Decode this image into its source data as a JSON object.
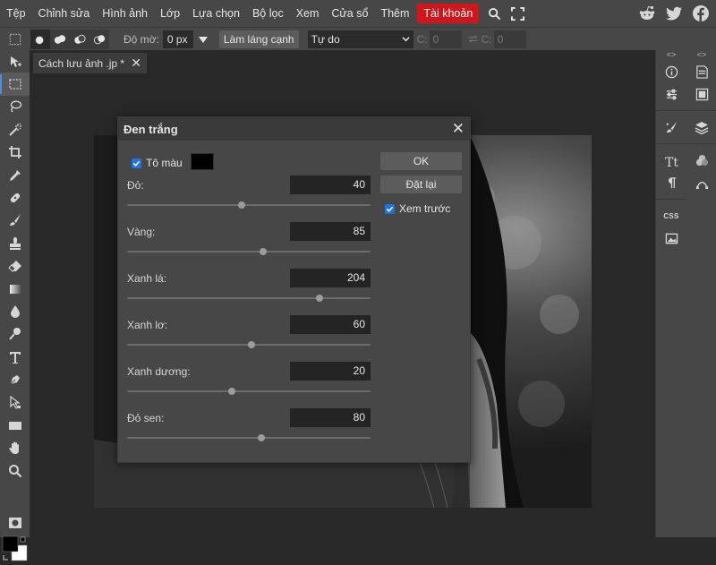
{
  "menu": {
    "items": [
      "Tệp",
      "Chỉnh sửa",
      "Hình ảnh",
      "Lớp",
      "Lựa chọn",
      "Bộ lọc",
      "Xem",
      "Cửa sổ",
      "Thêm"
    ],
    "account": "Tài khoản",
    "icons": [
      "search-icon",
      "fullscreen-icon"
    ],
    "social": [
      "reddit-icon",
      "twitter-icon",
      "facebook-icon"
    ]
  },
  "options": {
    "feather_label": "Độ mờ:",
    "feather_value": "0 px",
    "antialias_button": "Làm láng cạnh",
    "mode_value": "Tự do",
    "width_label": "C:",
    "width_value": "0",
    "height_label": "C:",
    "height_value": "0"
  },
  "tab": {
    "title": "Cách lưu ảnh .jp *",
    "close": "✕"
  },
  "dialog": {
    "title": "Đen trắng",
    "close": "✕",
    "tint_label": "Tô màu",
    "tint_checked": true,
    "tint_color": "#000000",
    "ok_label": "OK",
    "reset_label": "Đặt lại",
    "preview_label": "Xem trước",
    "preview_checked": true,
    "sliders": [
      {
        "label": "Đỏ:",
        "value": "40",
        "fraction": 0.47
      },
      {
        "label": "Vàng:",
        "value": "85",
        "fraction": 0.56
      },
      {
        "label": "Xanh lá:",
        "value": "204",
        "fraction": 0.79
      },
      {
        "label": "Xanh lơ:",
        "value": "60",
        "fraction": 0.51
      },
      {
        "label": "Xanh dương:",
        "value": "20",
        "fraction": 0.43
      },
      {
        "label": "Đỏ sen:",
        "value": "80",
        "fraction": 0.55
      }
    ]
  },
  "right_panel": {
    "collapse_glyph": "<>",
    "css_label": "CSS"
  },
  "colors": {
    "accent": "#d0151b",
    "checkbox": "#1e73e8"
  }
}
